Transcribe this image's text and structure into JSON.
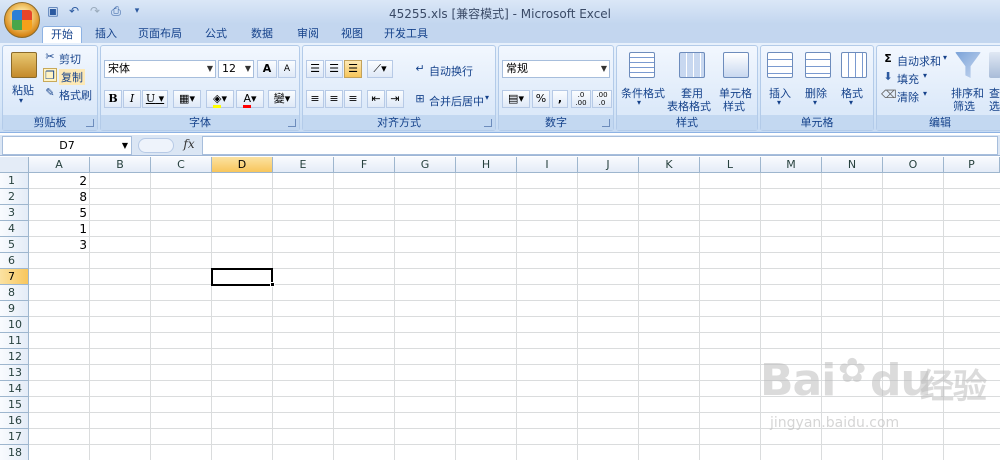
{
  "window": {
    "title": "45255.xls  [兼容模式] - Microsoft Excel"
  },
  "qat": {
    "save_icon": "floppy-icon",
    "undo_icon": "undo-icon",
    "redo_icon": "redo-icon",
    "preview_icon": "print-preview-icon"
  },
  "tabs": [
    {
      "label": "开始",
      "active": true
    },
    {
      "label": "插入"
    },
    {
      "label": "页面布局"
    },
    {
      "label": "公式"
    },
    {
      "label": "数据"
    },
    {
      "label": "审阅"
    },
    {
      "label": "视图"
    },
    {
      "label": "开发工具"
    }
  ],
  "ribbon": {
    "clipboard": {
      "label": "剪贴板",
      "paste": "粘贴",
      "cut": "剪切",
      "copy": "复制",
      "format_painter": "格式刷"
    },
    "font": {
      "label": "字体",
      "font_name": "宋体",
      "font_size": "12",
      "grow": "A",
      "shrink": "A",
      "bold": "B",
      "italic": "I",
      "underline": "U",
      "font_color_letter": "A",
      "phonetic": "變"
    },
    "alignment": {
      "label": "对齐方式",
      "wrap_text": "自动换行",
      "merge_center": "合并后居中"
    },
    "number": {
      "label": "数字",
      "format": "常规",
      "percent": "%",
      "comma": ",",
      "inc_decimal": ".0 .00",
      "dec_decimal": ".00 .0"
    },
    "styles": {
      "label": "样式",
      "conditional": "条件格式",
      "table_line1": "套用",
      "table_line2": "表格格式",
      "cell_line1": "单元格",
      "cell_line2": "样式"
    },
    "cells": {
      "label": "单元格",
      "insert": "插入",
      "delete": "删除",
      "format": "格式"
    },
    "editing": {
      "label": "编辑",
      "autosum": "自动求和",
      "fill": "填充",
      "clear": "清除",
      "sort_line1": "排序和",
      "sort_line2": "筛选",
      "find_line1": "查找",
      "find_line2": "选"
    }
  },
  "formula_bar": {
    "name_box": "D7",
    "fx": "fx",
    "value": ""
  },
  "sheet": {
    "columns": [
      "A",
      "B",
      "C",
      "D",
      "E",
      "F",
      "G",
      "H",
      "I",
      "J",
      "K",
      "L",
      "M",
      "N",
      "O",
      "P"
    ],
    "rows": [
      "1",
      "2",
      "3",
      "4",
      "5",
      "6",
      "7",
      "8",
      "9",
      "10",
      "11",
      "12",
      "13",
      "14",
      "15",
      "16",
      "17",
      "18"
    ],
    "selected_col": "D",
    "selected_row": "7",
    "cells": {
      "A1": "2",
      "A2": "8",
      "A3": "5",
      "A4": "1",
      "A5": "3"
    }
  },
  "watermark": {
    "brand": "Bai",
    "brand2": "du",
    "brand_cn": "经验",
    "url": "jingyan.baidu.com"
  },
  "colors": {
    "selected_header": "#f8c65c",
    "ribbon_bg": "#d6e6f8",
    "tab_text": "#15428b"
  }
}
